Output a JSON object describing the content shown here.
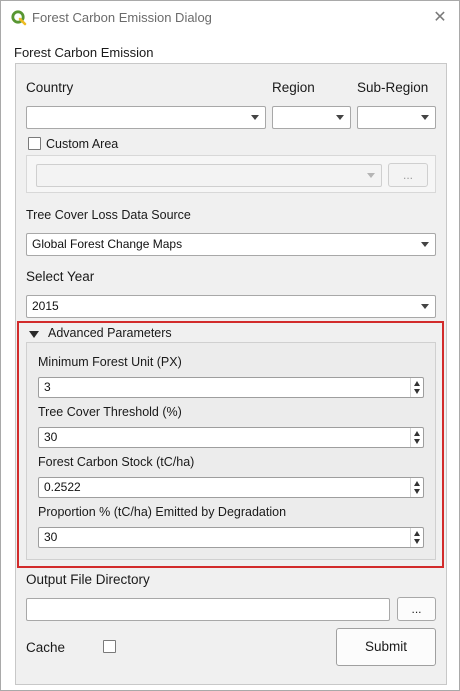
{
  "window": {
    "title": "Forest Carbon Emission Dialog",
    "close_glyph": "✕",
    "app_icon": "qgis-icon"
  },
  "group": {
    "title": "Forest Carbon Emission"
  },
  "location": {
    "country_label": "Country",
    "region_label": "Region",
    "subregion_label": "Sub-Region",
    "country_value": "",
    "region_value": "",
    "subregion_value": ""
  },
  "custom_area": {
    "label": "Custom Area",
    "checked": false,
    "combo_value": "",
    "browse_label": "..."
  },
  "data_source": {
    "label": "Tree Cover Loss Data Source",
    "value": "Global Forest Change Maps"
  },
  "year": {
    "label": "Select Year",
    "value": "2015"
  },
  "advanced": {
    "title": "Advanced Parameters",
    "expanded": true,
    "min_forest_unit_label": "Minimum Forest Unit (PX)",
    "min_forest_unit_value": "3",
    "tree_cover_threshold_label": "Tree Cover Threshold (%)",
    "tree_cover_threshold_value": "30",
    "carbon_stock_label": "Forest Carbon Stock (tC/ha)",
    "carbon_stock_value": "0.2522",
    "degradation_label": "Proportion % (tC/ha) Emitted by Degradation",
    "degradation_value": "30"
  },
  "output": {
    "label": "Output File Directory",
    "value": "",
    "browse_label": "..."
  },
  "cache": {
    "label": "Cache",
    "checked": false
  },
  "submit": {
    "label": "Submit"
  },
  "colors": {
    "highlight": "#d22b2b",
    "group_bg": "#f0f0f0",
    "qgis_green": "#589632",
    "qgis_yellow": "#eebb22"
  }
}
